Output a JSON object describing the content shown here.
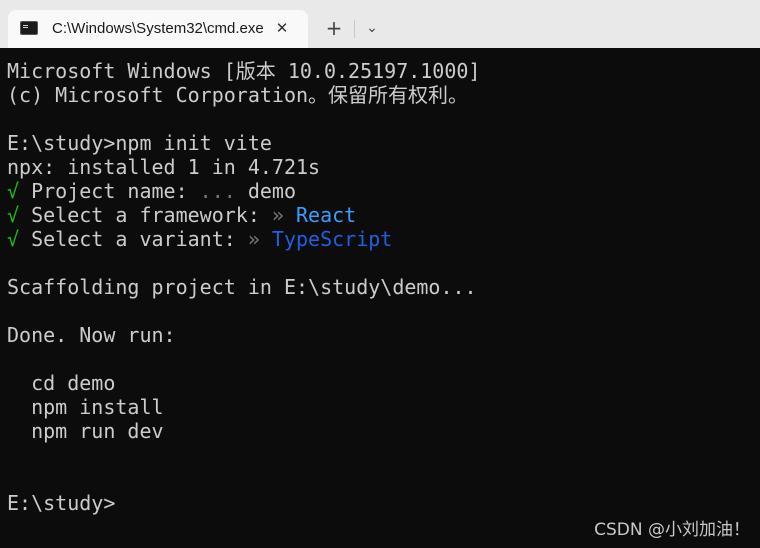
{
  "tabbar": {
    "tab_title": "C:\\Windows\\System32\\cmd.exe",
    "close_symbol": "✕",
    "new_tab_symbol": "+",
    "dropdown_symbol": "⌄",
    "icon": "cmd-icon"
  },
  "console": {
    "line1": "Microsoft Windows [版本 10.0.25197.1000]",
    "line2": "(c) Microsoft Corporation。保留所有权利。",
    "line3": "E:\\study>npm init vite",
    "line4": "npx: installed 1 in 4.721s",
    "line5_check": "√",
    "line5_label": " Project name: ",
    "line5_dots": "...",
    "line5_value": " demo",
    "line6_check": "√",
    "line6_label": " Select a framework: ",
    "line6_arrow": "»",
    "line6_value": " React",
    "line7_check": "√",
    "line7_label": " Select a variant: ",
    "line7_arrow": "»",
    "line7_value": " TypeScript",
    "line8": "Scaffolding project in E:\\study\\demo...",
    "line9": "Done. Now run:",
    "line10": "  cd demo",
    "line11": "  npm install",
    "line12": "  npm run dev",
    "line13": "E:\\study>"
  },
  "watermark": "CSDN @小刘加油！",
  "colors": {
    "background": "#0c0c0c",
    "text": "#cccccc",
    "check": "#16c60c",
    "react": "#3b9eff",
    "typescript": "#1f5fe0"
  }
}
